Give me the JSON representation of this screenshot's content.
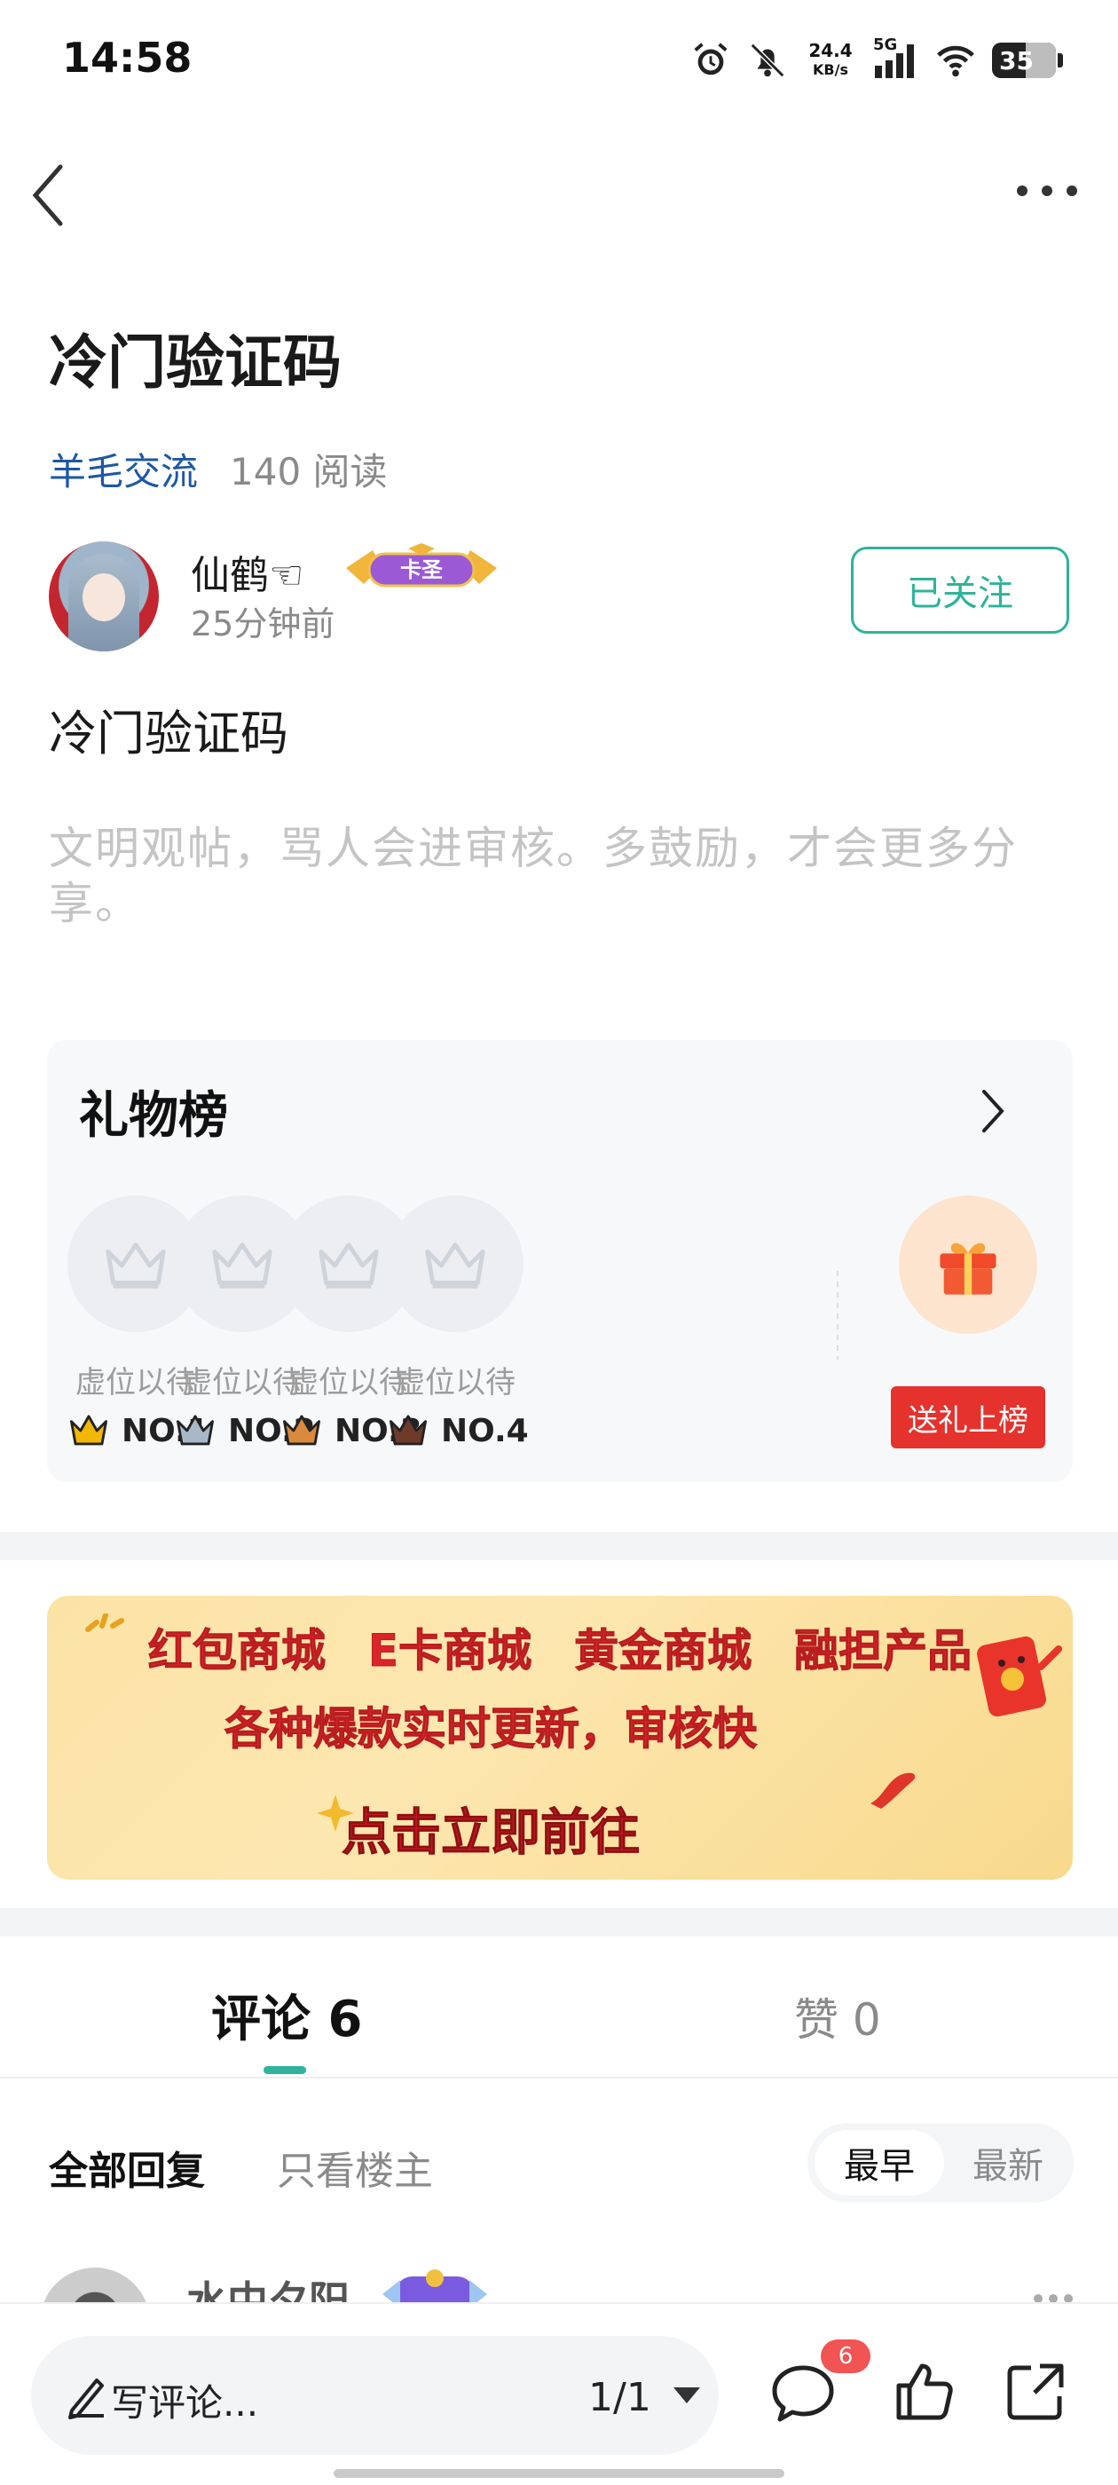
{
  "status_bar": {
    "time": "14:58",
    "net_speed_value": "24.4",
    "net_speed_unit": "KB/s",
    "signal_label": "5G",
    "battery": "35",
    "icons": [
      "alarm-icon",
      "bell-off-icon",
      "signal-icon",
      "wifi-icon",
      "battery-icon"
    ]
  },
  "nav": {
    "back_icon": "chevron-left-icon",
    "more_icon": "more-dots-icon"
  },
  "post": {
    "title": "冷门验证码",
    "forum": "羊毛交流",
    "reads": "140 阅读",
    "author": {
      "name": "仙鹤☜",
      "badge": "卡圣",
      "time": "25分钟前",
      "follow_label": "已关注"
    },
    "body": "冷门验证码",
    "hint": "文明观帖，骂人会进审核。多鼓励，才会更多分享。"
  },
  "gift_board": {
    "title": "礼物榜",
    "slots": [
      {
        "label": "虚位以待",
        "rank": "NO.1",
        "crown_color": "#f2b705"
      },
      {
        "label": "虚位以待",
        "rank": "NO.2",
        "crown_color": "#a9b8c6"
      },
      {
        "label": "虚位以待",
        "rank": "NO.3",
        "crown_color": "#d98a3c"
      },
      {
        "label": "虚位以待",
        "rank": "NO.4",
        "crown_color": "#6e3b2a"
      }
    ],
    "send_label": "送礼上榜"
  },
  "banner": {
    "line1": [
      "红包商城",
      "E卡商城",
      "黄金商城",
      "融担产品"
    ],
    "line2": "各种爆款实时更新，审核快",
    "line3": "点击立即前往"
  },
  "tabs": {
    "comments": "评论 6",
    "likes": "赞 0"
  },
  "filters": {
    "all": "全部回复",
    "op_only": "只看楼主",
    "sort_earliest": "最早",
    "sort_latest": "最新"
  },
  "first_comment": {
    "name": "水中夕阳"
  },
  "bottom_bar": {
    "write_placeholder": "写评论...",
    "page": "1/1",
    "comment_count": "6"
  },
  "colors": {
    "accent": "#2fb39a",
    "link": "#1d57a6",
    "red": "#e5322d"
  }
}
